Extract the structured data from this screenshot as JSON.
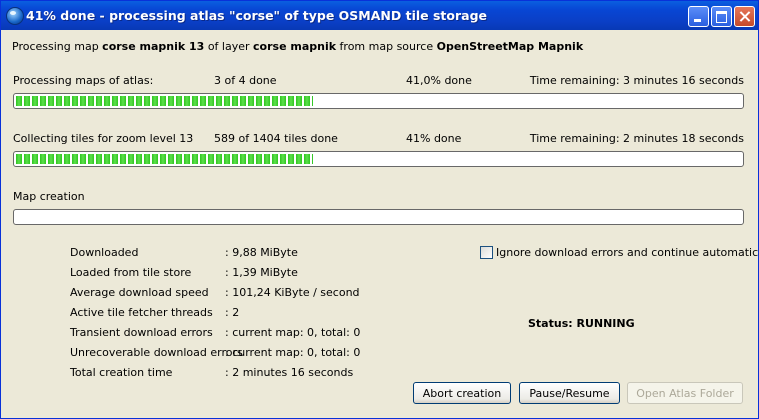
{
  "window": {
    "title": "41% done - processing atlas \"corse\" of type OSMAND tile storage"
  },
  "processing_line": {
    "p1": "Processing map ",
    "map_name": "corse mapnik 13",
    "p2": " of layer ",
    "layer_name": "corse mapnik",
    "p3": " from map source ",
    "source_name": "OpenStreetMap Mapnik"
  },
  "maps_progress": {
    "label": "Processing maps of atlas:",
    "count": "3 of 4 done",
    "percent": "41,0% done",
    "remaining": "Time remaining: 3 minutes 16 seconds",
    "fraction": 0.41
  },
  "tiles_progress": {
    "label": "Collecting tiles for zoom level 13",
    "count": "589 of 1404 tiles done",
    "percent": "41% done",
    "remaining": "Time remaining: 2 minutes 18 seconds",
    "fraction": 0.41
  },
  "map_creation": {
    "label": "Map creation",
    "fraction": 0
  },
  "stats": [
    {
      "label": "Downloaded",
      "value": ": 9,88 MiByte"
    },
    {
      "label": "Loaded from tile store",
      "value": ": 1,39 MiByte"
    },
    {
      "label": "Average download speed",
      "value": ": 101,24 KiByte / second"
    },
    {
      "label": "Active tile fetcher threads",
      "value": ": 2"
    },
    {
      "label": "Transient download errors",
      "value": ": current map: 0, total: 0"
    },
    {
      "label": "Unrecoverable download errors",
      "value": ": current map: 0, total: 0"
    },
    {
      "label": "Total creation time",
      "value": ": 2 minutes 16 seconds"
    }
  ],
  "ignore_errors": {
    "label": "Ignore download errors and continue automatically",
    "checked": false
  },
  "status": {
    "text": "Status: RUNNING"
  },
  "buttons": {
    "abort": "Abort creation",
    "pause": "Pause/Resume",
    "open_folder": "Open Atlas Folder"
  }
}
